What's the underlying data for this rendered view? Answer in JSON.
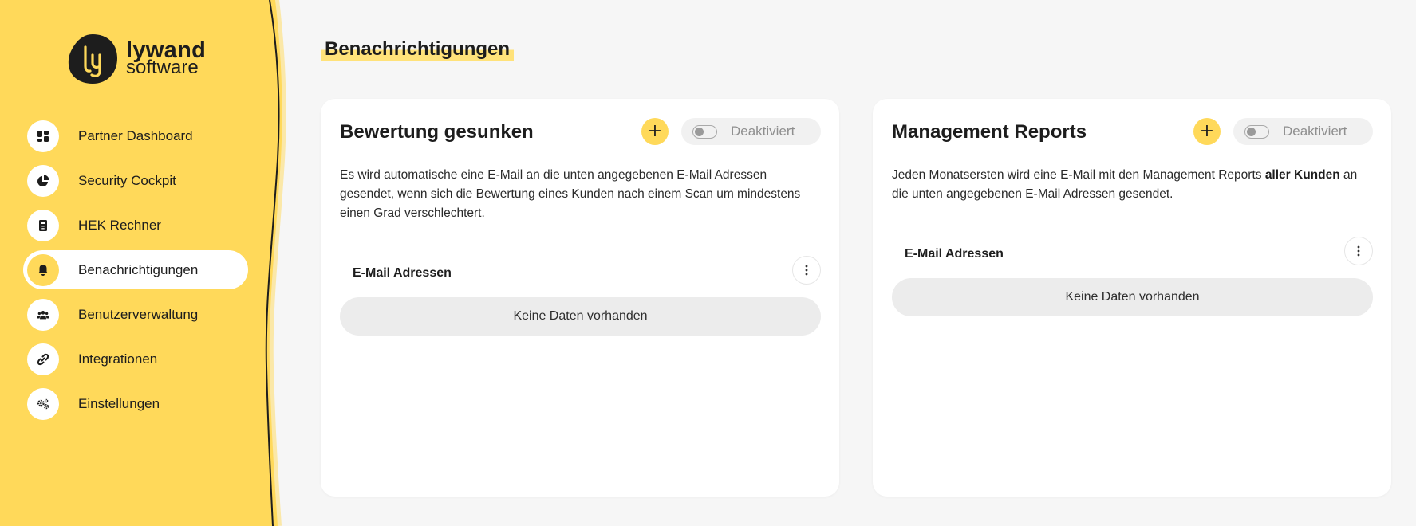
{
  "brand": {
    "name_line1": "lywand",
    "name_line2": "software",
    "accent": "#ffd95a",
    "sidebar_color": "#ffd95a"
  },
  "sidebar": {
    "items": [
      {
        "label": "Partner Dashboard",
        "icon": "dashboard-icon",
        "active": false
      },
      {
        "label": "Security Cockpit",
        "icon": "pie-chart-icon",
        "active": false
      },
      {
        "label": "HEK Rechner",
        "icon": "calculator-icon",
        "active": false
      },
      {
        "label": "Benachrichtigungen",
        "icon": "bell-icon",
        "active": true
      },
      {
        "label": "Benutzerverwaltung",
        "icon": "users-icon",
        "active": false
      },
      {
        "label": "Integrationen",
        "icon": "link-icon",
        "active": false
      },
      {
        "label": "Einstellungen",
        "icon": "gears-icon",
        "active": false
      }
    ]
  },
  "main": {
    "title": "Benachrichtigungen",
    "cards": [
      {
        "title": "Bewertung gesunken",
        "add_label": "+",
        "toggle_label": "Deaktiviert",
        "toggle_on": false,
        "description": "Es wird automatische eine E-Mail an die unten angegebenen E-Mail Adressen gesendet, wenn sich die Bewertung eines Kunden nach einem Scan um mindestens einen Grad verschlechtert.",
        "section_label": "E-Mail Adressen",
        "empty_text": "Keine Daten vorhanden"
      },
      {
        "title": "Management Reports",
        "add_label": "+",
        "toggle_label": "Deaktiviert",
        "toggle_on": false,
        "description_pre": "Jeden Monatsersten wird eine E-Mail mit den Management Reports ",
        "description_bold": "aller Kunden",
        "description_post": " an die unten angegebenen E-Mail Adressen gesendet.",
        "section_label": "E-Mail Adressen",
        "empty_text": "Keine Daten vorhanden"
      }
    ]
  }
}
